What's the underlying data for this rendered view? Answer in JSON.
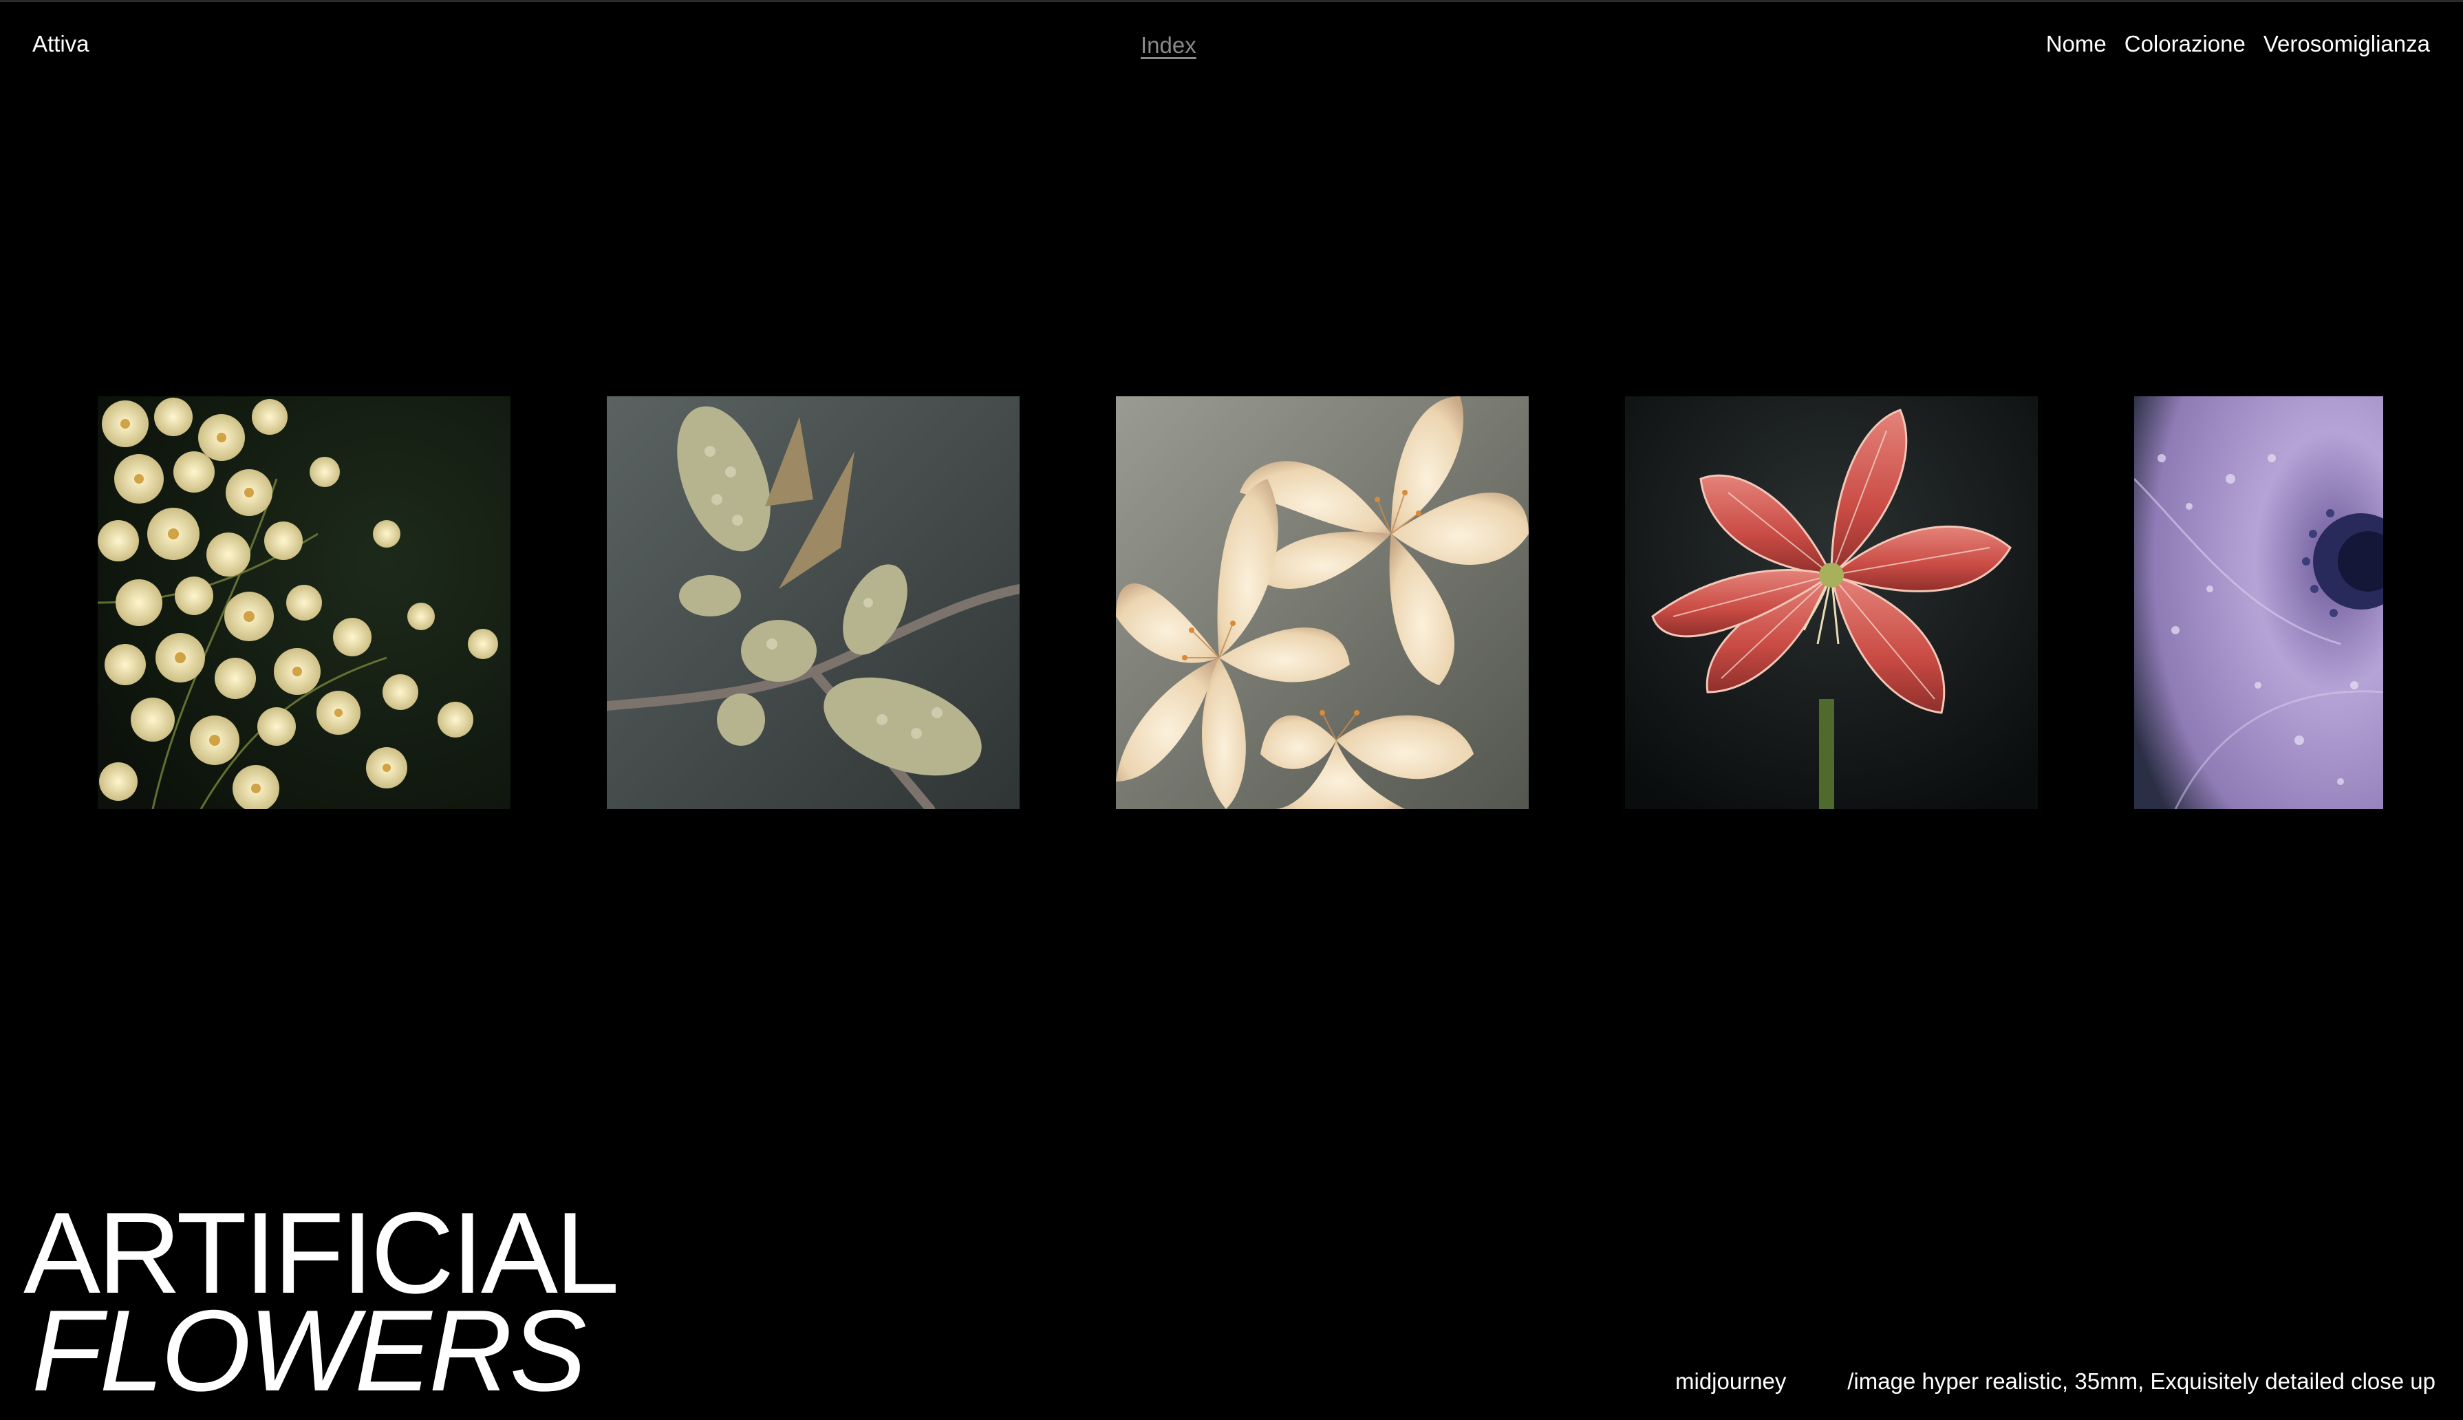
{
  "header": {
    "left_label": "Attiva",
    "center_link": "Index",
    "right_links": [
      "Nome",
      "Colorazione",
      "Verosomiglianza"
    ]
  },
  "gallery": {
    "images": [
      {
        "subject": "cluster of small cream blossoms",
        "palette": [
          "#1b2418",
          "#e8dfb0",
          "#6d7a3c"
        ]
      },
      {
        "subject": "budding branch with catkins",
        "palette": [
          "#4c5352",
          "#c9c3a0",
          "#8d8578"
        ]
      },
      {
        "subject": "pale peach lily blossoms",
        "palette": [
          "#8a8c86",
          "#f3e4c8",
          "#e2b78a"
        ]
      },
      {
        "subject": "red striped amaryllis",
        "palette": [
          "#0e1212",
          "#d85a52",
          "#f1c3b5"
        ]
      },
      {
        "subject": "lavender anemone with water drops",
        "palette": [
          "#1a1f2d",
          "#b7a4d3",
          "#2b2a5e"
        ]
      }
    ]
  },
  "title": {
    "line1": "ARTIFICIAL",
    "line2": "FLOWERS"
  },
  "footer": {
    "tool": "midjourney",
    "prompt": "/image hyper realistic, 35mm, Exquisitely detailed close up"
  },
  "colors": {
    "background": "#000000",
    "text": "#ffffff",
    "muted_link": "#8a8a8a"
  }
}
